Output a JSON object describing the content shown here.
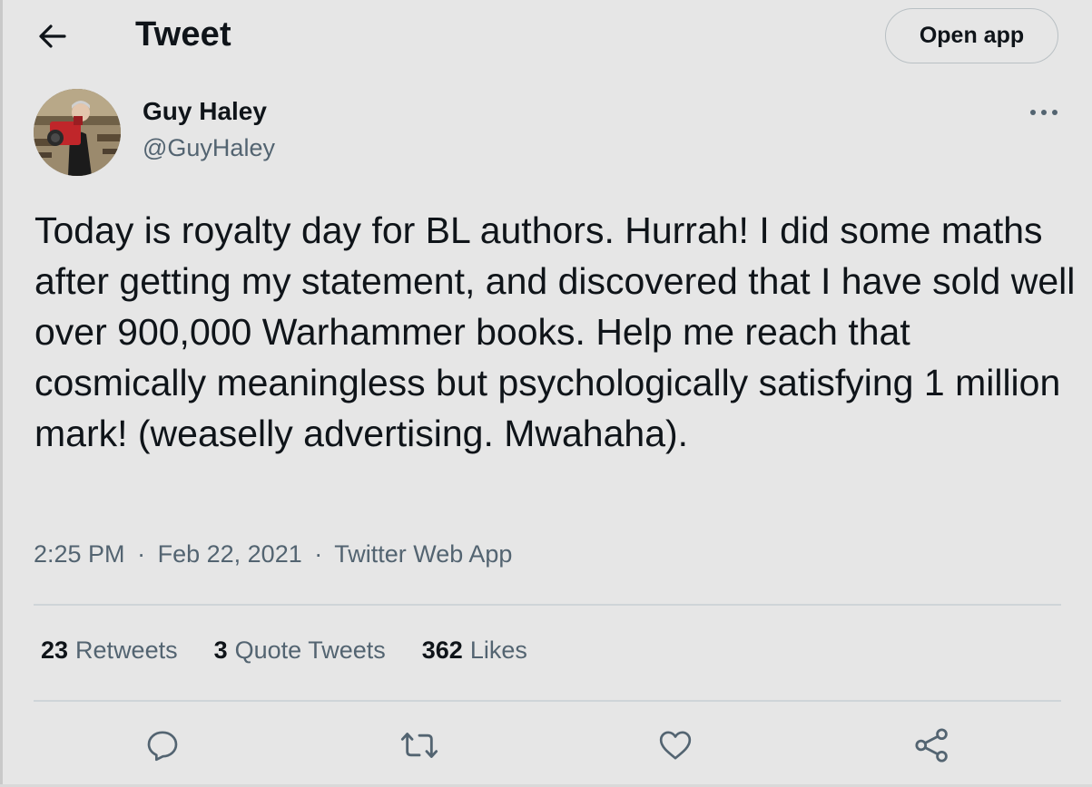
{
  "header": {
    "title": "Tweet",
    "back_icon": "arrow-left-icon",
    "open_app_label": "Open app"
  },
  "author": {
    "name": "Guy Haley",
    "handle": "@GuyHaley"
  },
  "tweet": {
    "text": "Today is royalty day for BL authors. Hurrah! I did some maths after getting my statement, and discovered that I have sold well over 900,000 Warhammer books. Help me reach that cosmically meaningless but psychologically satisfying 1 million mark! (weaselly advertising. Mwahaha).",
    "time": "2:25 PM",
    "date": "Feb 22, 2021",
    "source": "Twitter Web App",
    "separator": "·"
  },
  "stats": {
    "retweets_count": "23",
    "retweets_label": "Retweets",
    "quotes_count": "3",
    "quotes_label": "Quote Tweets",
    "likes_count": "362",
    "likes_label": "Likes"
  },
  "actions": [
    "reply-icon",
    "retweet-icon",
    "like-icon",
    "share-icon"
  ],
  "colors": {
    "background": "#e6e6e6",
    "text": "#0f1419",
    "secondary_text": "#536471",
    "border": "#cfd4d8"
  }
}
